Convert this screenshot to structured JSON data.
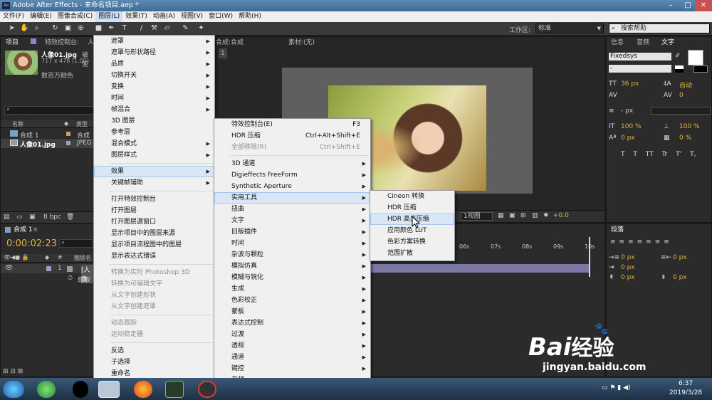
{
  "window": {
    "title": "Adobe After Effects - 未命名项目.aep *"
  },
  "menubar": [
    "文件(F)",
    "编辑(E)",
    "图像合成(C)",
    "图层(L)",
    "效果(T)",
    "动画(A)",
    "视图(V)",
    "窗口(W)",
    "帮助(H)"
  ],
  "toolbar": {
    "workspace_label": "工作区:",
    "workspace_value": "标准",
    "search_placeholder": "搜索帮助"
  },
  "project_panel": {
    "tab": "项目",
    "effects_tab": "特效控制台:",
    "effects_tab_item": "人",
    "asset_name": "人像01.jpg",
    "asset_used": "被使",
    "asset_dims": "717 x 478 (1.00)",
    "asset_colors": "数百万颜色",
    "col_name": "名称",
    "col_type": "类型",
    "items": [
      {
        "name": "合成 1",
        "type": "合成"
      },
      {
        "name": "人像01.jpg",
        "type": "JPEG"
      }
    ],
    "bpc": "8 bpc"
  },
  "comp_panel": {
    "tab": "合成:合成",
    "footage_tab": "素材:(无)",
    "sub_tab": "1",
    "views": "1视图",
    "exposure": "+0.0"
  },
  "right_panels": {
    "tabs": [
      "信息",
      "音频",
      "文字"
    ],
    "font": "Fixedsys",
    "font_style": "-",
    "size": "36 px",
    "leading": "自动",
    "kerning": "",
    "tracking": "0",
    "stroke": "- px",
    "vscale": "100 %",
    "hscale": "100 %",
    "baseline": "0 px",
    "tsume": "0 %",
    "text_styles": [
      "T",
      "T",
      "TT",
      "Tr",
      "T'",
      "T,"
    ],
    "para_tab": "段落",
    "indents": [
      "0 px",
      "0 px",
      "0 px",
      "0 px",
      "0 px"
    ]
  },
  "timeline": {
    "tab": "合成 1",
    "time": "0:00:02:23",
    "layer_col": "图层名",
    "layer_num": "1",
    "layer_name": "[人像",
    "prop": "缩放",
    "ruler": [
      "06s",
      "07s",
      "08s",
      "09s",
      "10s"
    ]
  },
  "context_menu": {
    "items": [
      {
        "label": "遮罩",
        "sub": true
      },
      {
        "label": "遮罩与形状路径",
        "sub": true
      },
      {
        "label": "品质",
        "sub": true
      },
      {
        "label": "切换开关",
        "sub": true
      },
      {
        "label": "变换",
        "sub": true
      },
      {
        "label": "时间",
        "sub": true
      },
      {
        "label": "帧混合",
        "sub": true
      },
      {
        "label": "3D 图层"
      },
      {
        "label": "参考层"
      },
      {
        "label": "混合模式",
        "sub": true
      },
      {
        "label": "图层样式",
        "sub": true
      },
      {
        "sep": true
      },
      {
        "label": "效果",
        "sub": true,
        "hl": true
      },
      {
        "label": "关键帧辅助",
        "sub": true
      },
      {
        "sep": true
      },
      {
        "label": "打开特效控制台"
      },
      {
        "label": "打开图层"
      },
      {
        "label": "打开图层源窗口"
      },
      {
        "label": "显示项目中的图层来源"
      },
      {
        "label": "显示项目流程图中的图层"
      },
      {
        "label": "显示表达式错误"
      },
      {
        "sep": true
      },
      {
        "label": "转换为实时 Photoshop 3D",
        "dis": true
      },
      {
        "label": "转换为可编辑文字",
        "dis": true
      },
      {
        "label": "从文字创建形状",
        "dis": true
      },
      {
        "label": "从文字创建遮罩",
        "dis": true
      },
      {
        "sep": true
      },
      {
        "label": "动态跟踪",
        "dis": true
      },
      {
        "label": "运动稳定器",
        "dis": true
      },
      {
        "sep": true
      },
      {
        "label": "反选"
      },
      {
        "label": "子选择"
      },
      {
        "label": "重命名"
      }
    ]
  },
  "effects_menu": {
    "items": [
      {
        "label": "特效控制台(E)",
        "sc": "F3"
      },
      {
        "label": "HDR 压缩",
        "sc": "Ctrl+Alt+Shift+E"
      },
      {
        "label": "全部移除(R)",
        "sc": "Ctrl+Shift+E",
        "dis": true
      },
      {
        "sep": true
      },
      {
        "label": "3D 通道",
        "sub": true
      },
      {
        "label": "Digieffects FreeForm",
        "sub": true
      },
      {
        "label": "Synthetic Aperture",
        "sub": true
      },
      {
        "label": "实用工具",
        "sub": true,
        "hl": true
      },
      {
        "label": "扭曲",
        "sub": true
      },
      {
        "label": "文字",
        "sub": true
      },
      {
        "label": "旧版插件",
        "sub": true
      },
      {
        "label": "时间",
        "sub": true
      },
      {
        "label": "杂波与颗粒",
        "sub": true
      },
      {
        "label": "模拟仿真",
        "sub": true
      },
      {
        "label": "模糊与锐化",
        "sub": true
      },
      {
        "label": "生成",
        "sub": true
      },
      {
        "label": "色彩校正",
        "sub": true
      },
      {
        "label": "蒙板",
        "sub": true
      },
      {
        "label": "表达式控制",
        "sub": true
      },
      {
        "label": "过渡",
        "sub": true
      },
      {
        "label": "透视",
        "sub": true
      },
      {
        "label": "通道",
        "sub": true
      },
      {
        "label": "键控",
        "sub": true
      },
      {
        "label": "音频",
        "sub": true
      },
      {
        "label": "风格化",
        "sub": true
      }
    ]
  },
  "utility_menu": {
    "items": [
      {
        "label": "Cineon 转换"
      },
      {
        "label": "HDR 压缩"
      },
      {
        "label": "HDR 高光压缩",
        "hl": true
      },
      {
        "label": "应用颜色 LUT"
      },
      {
        "label": "色彩方案转换"
      },
      {
        "label": "范围扩散"
      }
    ]
  },
  "taskbar": {
    "time": "6:37",
    "date": "2019/3/28"
  },
  "watermark": {
    "logo": "Bai",
    "logo2": "经验",
    "url": "jingyan.baidu.com"
  }
}
